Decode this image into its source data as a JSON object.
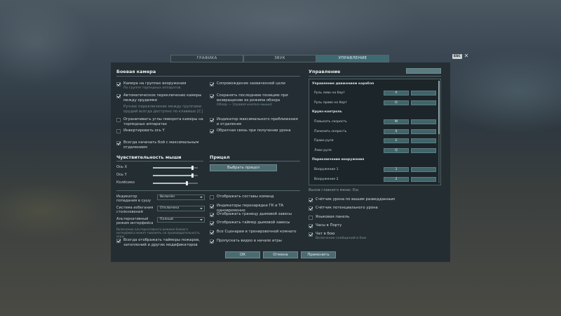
{
  "tabs": [
    {
      "label": "ГРАФИКА",
      "active": false
    },
    {
      "label": "ЗВУК",
      "active": false
    },
    {
      "label": "УПРАВЛЕНИЕ",
      "active": true
    }
  ],
  "esc": {
    "key": "ESC",
    "close": "✕"
  },
  "combat_camera": {
    "title": "Боевая камера",
    "left": [
      {
        "label": "Камера на группах вооружения",
        "sub": "По группе торпедных аппаратов",
        "checked": true
      },
      {
        "label": "Автоматическое переключение камеры между орудиями",
        "checked": true
      },
      {
        "label": "Ручное переключение между группами орудий всегда доступно по клавише [C]",
        "checked": false,
        "disabled": true
      },
      {
        "label": "Ограничивать углы поворота камеры на торпедных аппаратах",
        "checked": false
      },
      {
        "label": "Инвертировать ось Y",
        "checked": false
      },
      {
        "label": "Всегда начинать бой с максимальным отдалением",
        "checked": true
      }
    ],
    "right": [
      {
        "label": "Сопровождение захваченной цели",
        "checked": true
      },
      {
        "label": "Сохранять последнюю позицию при возвращении из режима обзора",
        "sub": "Обзор — [правая кнопка мыши]",
        "checked": true
      },
      {
        "label": "Индикатор максимального приближения и отдаления",
        "checked": true
      },
      {
        "label": "Обратная связь при получении урона",
        "checked": true
      }
    ]
  },
  "mouse": {
    "title": "Чувствительность мыши",
    "sliders": [
      {
        "label": "Ось X",
        "value": 0.88
      },
      {
        "label": "Ось Y",
        "value": 0.88
      },
      {
        "label": "Колёсико",
        "value": 0.75
      }
    ]
  },
  "sight": {
    "title": "Прицел",
    "button": "Выбрать прицел"
  },
  "selects": [
    {
      "label": "Индикатор попадания в сушу",
      "value": "Включён"
    },
    {
      "label": "Система избегания столкновений",
      "value": "Отключена"
    },
    {
      "label": "Альтернативный режим интерфейса",
      "value": "Полный"
    }
  ],
  "selects_note": "Включение альтернативного режима боевого интерфейса может повлиять на производительность игры",
  "bottom_left_check": {
    "label": "Всегда отображать таймеры пожаров, затоплений и других модификаторов",
    "checked": true
  },
  "middle_checks": [
    {
      "label": "Отображать составы команд",
      "checked": false
    },
    {
      "label": "Индикаторы перезарядки ГК и ТА одновременно",
      "checked": true
    },
    {
      "label": "Отображать границу дымовой завесы",
      "checked": true
    },
    {
      "label": "Отображать таймер дымовой завесы",
      "checked": true
    },
    {
      "label": "Все Сценарии в тренировочной комнате",
      "checked": true
    },
    {
      "label": "Пропускать видео в начале игры",
      "checked": true
    }
  ],
  "controls": {
    "title": "Управление",
    "sections": [
      {
        "title": "Управление движением корабля",
        "rows": [
          {
            "label": "Руль лево на борт",
            "k1": "A",
            "k2": ""
          },
          {
            "label": "Руль право на борт",
            "k1": "D",
            "k2": ""
          }
        ]
      },
      {
        "title": "Круиз-контроль",
        "rows": [
          {
            "label": "Повысить скорость",
            "k1": "W",
            "k2": ""
          },
          {
            "label": "Понизить скорость",
            "k1": "S",
            "k2": ""
          },
          {
            "label": "Право руля",
            "k1": "E",
            "k2": ""
          },
          {
            "label": "Лево руля",
            "k1": "Q",
            "k2": ""
          }
        ]
      },
      {
        "title": "Переключение вооружения",
        "rows": [
          {
            "label": "Вооружение 1",
            "k1": "1",
            "k2": ""
          },
          {
            "label": "Вооружение 2",
            "k1": "2",
            "k2": ""
          }
        ]
      }
    ],
    "main_menu_hint": "Вызов главного меню: Esc",
    "checks": [
      {
        "label": "Счётчик урона по вашим разведданным",
        "checked": true
      },
      {
        "label": "Счётчик потенциального урона",
        "checked": true
      },
      {
        "label": "Языковая панель",
        "checked": false
      },
      {
        "label": "Часы в Порту",
        "checked": true
      },
      {
        "label": "Чат в бою",
        "sub": "Включение сообщений в бою",
        "checked": true
      }
    ]
  },
  "buttons": {
    "ok": "ОК",
    "cancel": "Отмена",
    "apply": "Применить"
  }
}
